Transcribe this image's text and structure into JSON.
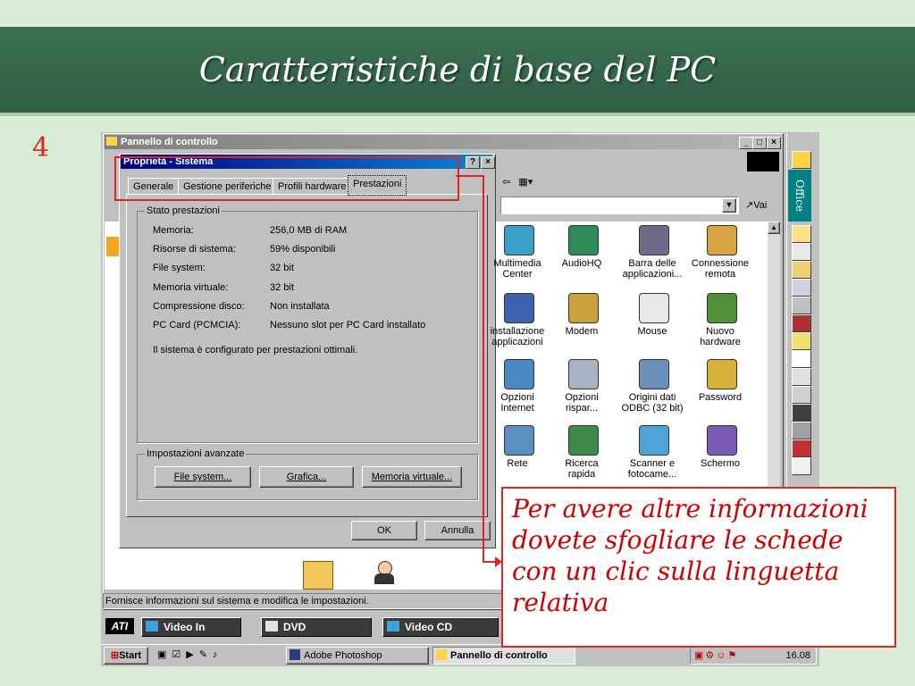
{
  "slide": {
    "title": "Caratteristiche di base del PC",
    "number": "4",
    "callout": "Per avere altre informazioni dovete sfogliare le schede con un clic sulla linguetta relativa"
  },
  "control_panel": {
    "title": "Pannello di controllo",
    "go_label": "Vai",
    "status": "Fornisce informazioni sul sistema e modifica le impostazioni.",
    "icons": [
      {
        "label": "Multimedia Center",
        "icon": "multimedia-icon"
      },
      {
        "label": "AudioHQ",
        "icon": "audiohq-icon"
      },
      {
        "label": "Barra delle applicazioni...",
        "icon": "taskbar-icon"
      },
      {
        "label": "Connessione remota",
        "icon": "dialup-icon"
      },
      {
        "label": "installazione applicazioni",
        "icon": "addremove-icon"
      },
      {
        "label": "Modem",
        "icon": "modem-icon"
      },
      {
        "label": "Mouse",
        "icon": "mouse-icon"
      },
      {
        "label": "Nuovo hardware",
        "icon": "hardware-icon"
      },
      {
        "label": "Opzioni Internet",
        "icon": "internet-icon"
      },
      {
        "label": "Opzioni rispar...",
        "icon": "power-icon"
      },
      {
        "label": "Origini dati ODBC (32 bit)",
        "icon": "odbc-icon"
      },
      {
        "label": "Password",
        "icon": "password-icon"
      },
      {
        "label": "Rete",
        "icon": "network-icon"
      },
      {
        "label": "Ricerca rapida",
        "icon": "search-icon"
      },
      {
        "label": "Scanner e fotocame...",
        "icon": "scanner-icon"
      },
      {
        "label": "Schermo",
        "icon": "display-icon"
      }
    ]
  },
  "dialog": {
    "title": "Proprietà - Sistema",
    "help_btn": "?",
    "close_btn": "×",
    "tabs": [
      "Generale",
      "Gestione periferiche",
      "Profili hardware",
      "Prestazioni"
    ],
    "group_stato": "Stato prestazioni",
    "rows": [
      {
        "label": "Memoria:",
        "value": "256,0 MB di RAM"
      },
      {
        "label": "Risorse di sistema:",
        "value": "59% disponibili"
      },
      {
        "label": "File system:",
        "value": "32 bit"
      },
      {
        "label": "Memoria virtuale:",
        "value": "32 bit"
      },
      {
        "label": "Compressione disco:",
        "value": "Non installata"
      },
      {
        "label": "PC Card (PCMCIA):",
        "value": "Nessuno slot per PC Card installato"
      }
    ],
    "summary": "Il sistema è configurato per prestazioni ottimali.",
    "group_avanzate": "Impostazioni avanzate",
    "btn_filesystem": "File system...",
    "btn_grafica": "Grafica...",
    "btn_memoria": "Memoria virtuale...",
    "ok": "OK",
    "annulla": "Annulla"
  },
  "ati_bar": {
    "video_in": "Video In",
    "dvd": "DVD",
    "video_cd": "Video CD"
  },
  "taskbar": {
    "start": "Start",
    "tasks": [
      "Adobe Photoshop",
      "Pannello di controllo"
    ],
    "clock": "16.08"
  },
  "office_bar": {
    "label": "Office"
  },
  "colors": {
    "banner": "#33654a",
    "accent_red": "#e0261f",
    "win_gray": "#c0c0c0",
    "title_blue": "#000080"
  }
}
